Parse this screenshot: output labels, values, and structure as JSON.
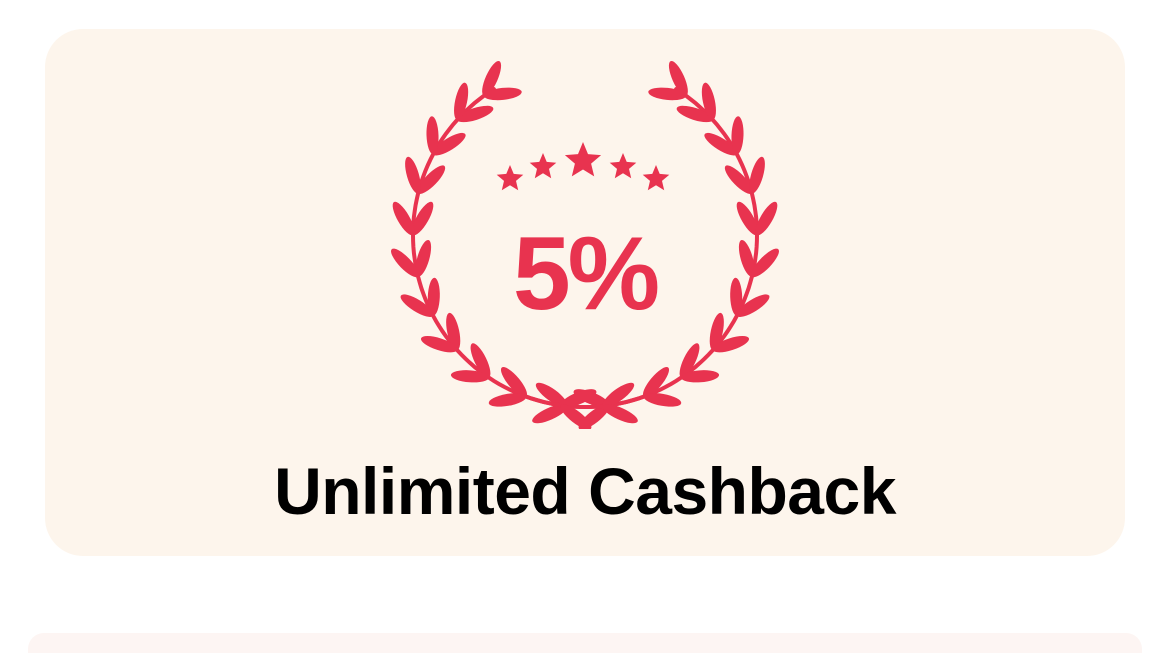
{
  "benefit_card": {
    "badge_value": "5%",
    "title": "Unlimited Cashback",
    "star_count": 5,
    "icon": "laurel-wreath-icon",
    "accent_color": "#e8334f",
    "background_color": "#fdf5ec",
    "title_color": "#000000"
  },
  "next_card": {
    "background_color": "#fdf5f3"
  }
}
